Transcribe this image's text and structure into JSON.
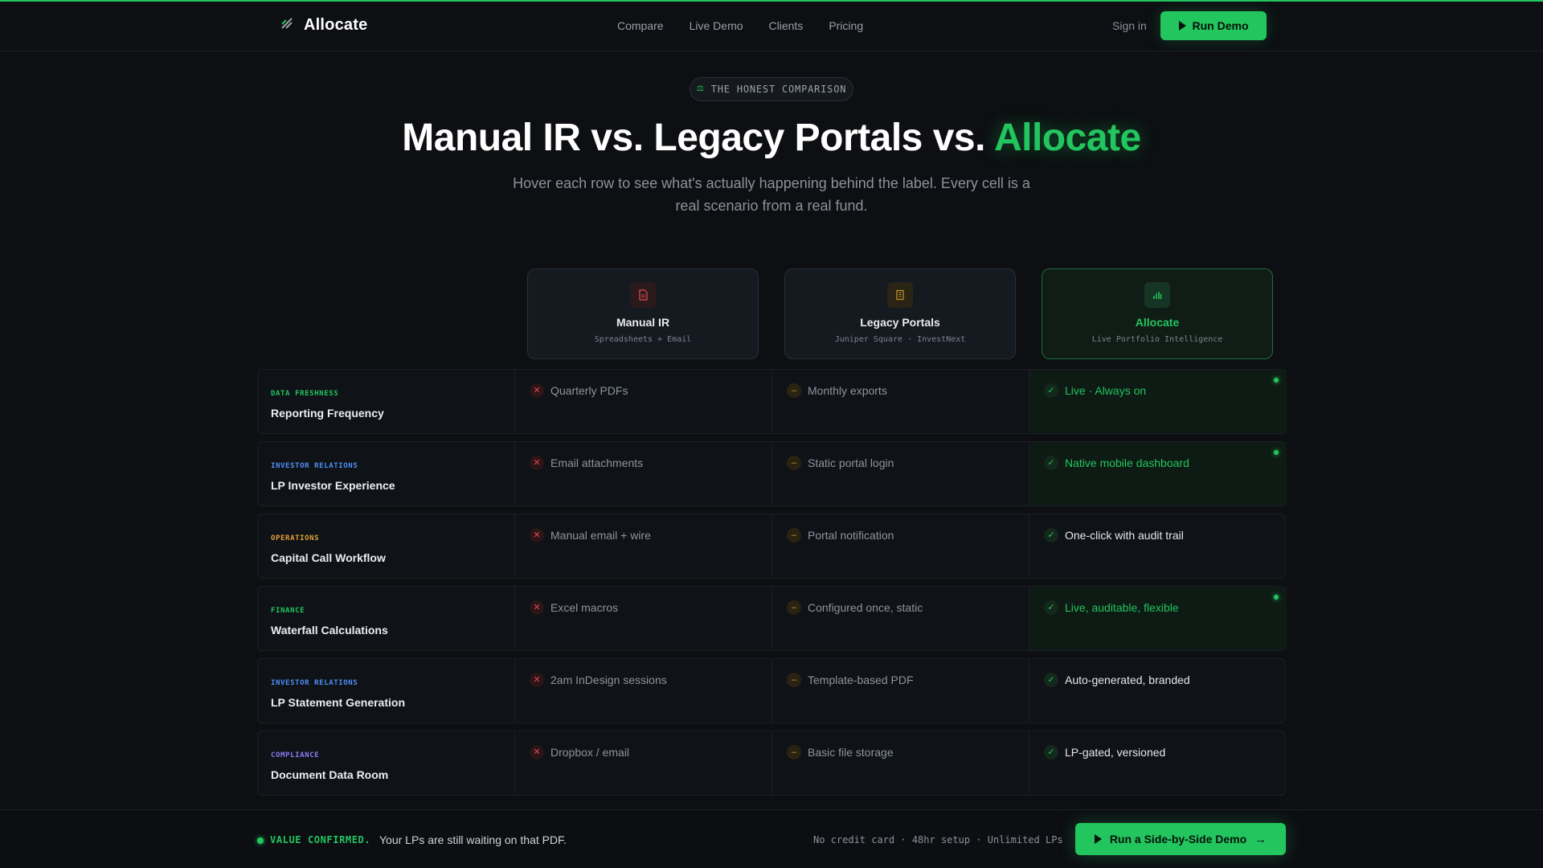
{
  "brand": {
    "name": "Allocate",
    "accent": "#22c55e"
  },
  "nav": {
    "links": [
      "Compare",
      "Live Demo",
      "Clients",
      "Pricing"
    ],
    "signin_label": "Sign in",
    "cta_label": "Run Demo"
  },
  "hero": {
    "eyebrow": "THE HONEST COMPARISON",
    "title_part1": "Manual IR vs. Legacy Portals vs. ",
    "title_accent": "Allocate",
    "subtitle": "Hover each row to see what's actually happening behind the label. Every cell is a real scenario from a real fund."
  },
  "columns": [
    {
      "name": "Manual IR",
      "sub": "Spreadsheets + Email",
      "icon": "document-icon"
    },
    {
      "name": "Legacy Portals",
      "sub": "Juniper Square · InvestNext",
      "icon": "building-icon"
    },
    {
      "name": "Allocate",
      "sub": "Live Portfolio Intelligence",
      "icon": "bar-chart-icon"
    }
  ],
  "rows": [
    {
      "category": "DATA FRESHNESS",
      "category_color": "#22c55e",
      "title": "Reporting Frequency",
      "manual": "Quarterly PDFs",
      "legacy": "Monthly exports",
      "allocate": "Live · Always on",
      "highlight": true
    },
    {
      "category": "INVESTOR RELATIONS",
      "category_color": "#4f8ff7",
      "title": "LP Investor Experience",
      "manual": "Email attachments",
      "legacy": "Static portal login",
      "allocate": "Native mobile dashboard",
      "highlight": true
    },
    {
      "category": "OPERATIONS",
      "category_color": "#e0a23a",
      "title": "Capital Call Workflow",
      "manual": "Manual email + wire",
      "legacy": "Portal notification",
      "allocate": "One-click with audit trail",
      "highlight": false
    },
    {
      "category": "FINANCE",
      "category_color": "#22c55e",
      "title": "Waterfall Calculations",
      "manual": "Excel macros",
      "legacy": "Configured once, static",
      "allocate": "Live, auditable, flexible",
      "highlight": true
    },
    {
      "category": "INVESTOR RELATIONS",
      "category_color": "#4f8ff7",
      "title": "LP Statement Generation",
      "manual": "2am InDesign sessions",
      "legacy": "Template-based PDF",
      "allocate": "Auto-generated, branded",
      "highlight": false
    },
    {
      "category": "COMPLIANCE",
      "category_color": "#8b7cf6",
      "title": "Document Data Room",
      "manual": "Dropbox / email",
      "legacy": "Basic file storage",
      "allocate": "LP-gated, versioned",
      "highlight": false
    }
  ],
  "bottom_bar": {
    "status": "VALUE CONFIRMED.",
    "message": "Your LPs are still waiting on that PDF.",
    "note": "No credit card · 48hr setup · Unlimited LPs",
    "cta_label": "Run a Side-by-Side Demo"
  }
}
